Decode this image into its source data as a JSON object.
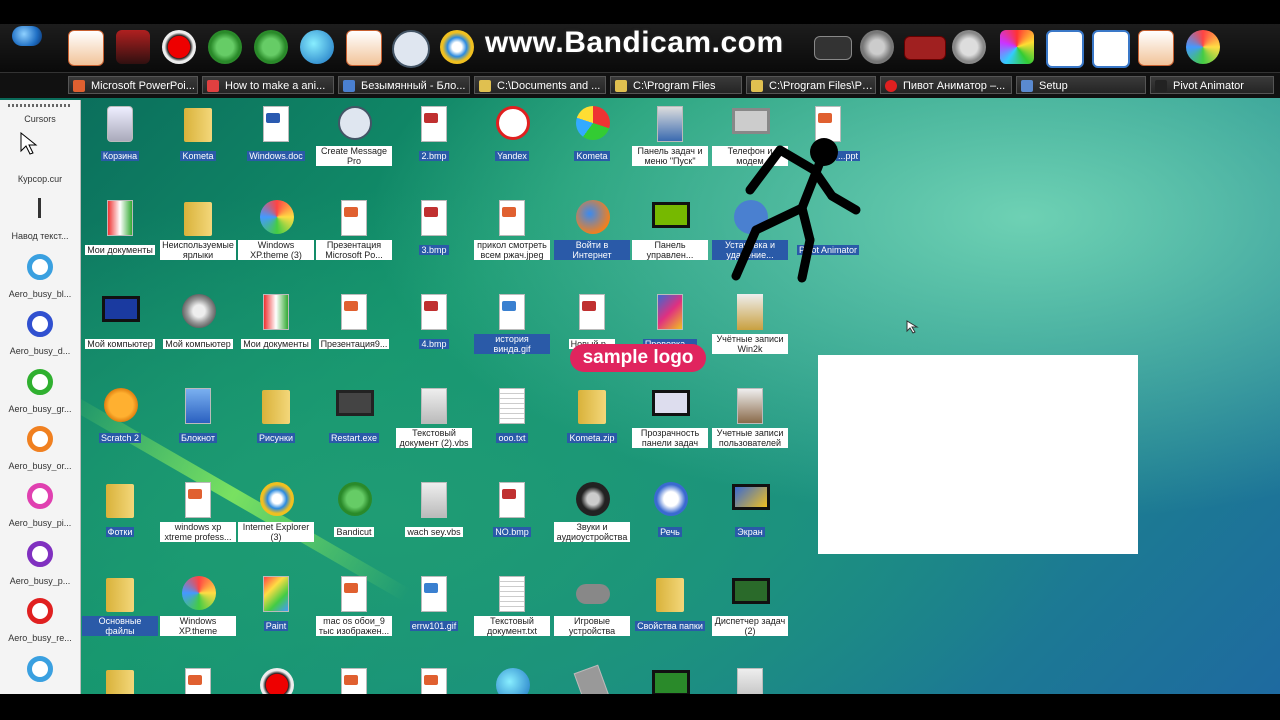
{
  "watermark": "www.Bandicam.com",
  "sample_logo": "sample logo",
  "taskbar": {
    "items": [
      {
        "label": "Microsoft PowerPoi...",
        "icon": "powerpoint-icon"
      },
      {
        "label": "How to make a ani...",
        "icon": "browser-icon"
      },
      {
        "label": "Безымянный - Бло...",
        "icon": "notepad-icon"
      },
      {
        "label": "C:\\Documents and ...",
        "icon": "folder-icon"
      },
      {
        "label": "C:\\Program Files",
        "icon": "folder-icon"
      },
      {
        "label": "C:\\Program Files\\Piv...",
        "icon": "folder-icon"
      },
      {
        "label": "Пивот Аниматор –...",
        "icon": "yandex-icon"
      },
      {
        "label": "Setup",
        "icon": "setup-icon"
      },
      {
        "label": "Pivot Animator",
        "icon": "pivot-icon"
      }
    ]
  },
  "cursor_panel": {
    "title": "Cursors",
    "items": [
      {
        "label": "Курсор.cur",
        "icon": "arrow-cursor-icon"
      },
      {
        "label": "Навод текст...",
        "icon": "text-cursor-icon"
      },
      {
        "label": "Aero_busy_bl...",
        "color": "#3aa0e0"
      },
      {
        "label": "Aero_busy_d...",
        "color": "#3050d0"
      },
      {
        "label": "Aero_busy_gr...",
        "color": "#30b030"
      },
      {
        "label": "Aero_busy_or...",
        "color": "#f08020"
      },
      {
        "label": "Aero_busy_pi...",
        "color": "#e040b0"
      },
      {
        "label": "Aero_busy_p...",
        "color": "#8030c0"
      },
      {
        "label": "Aero_busy_re...",
        "color": "#e02020"
      }
    ]
  },
  "desktop_icons": [
    {
      "label": "Корзина",
      "icon": "recycle-bin-icon"
    },
    {
      "label": "Kometa",
      "icon": "folder-icon"
    },
    {
      "label": "Windows.doc",
      "icon": "word-doc-icon"
    },
    {
      "label": "Create Message Pro",
      "icon": "rjl-icon"
    },
    {
      "label": "2.bmp",
      "icon": "bmp-icon"
    },
    {
      "label": "Yandex",
      "icon": "yandex-icon"
    },
    {
      "label": "Kometa",
      "icon": "kometa-icon"
    },
    {
      "label": "Панель задач и меню \"Пуск\"",
      "icon": "taskbar-settings-icon"
    },
    {
      "label": "Телефон и модем",
      "icon": "phone-icon"
    },
    {
      "label": "...ppt",
      "icon": "powerpoint-icon"
    },
    {
      "label": "Мои документы",
      "icon": "my-documents-icon"
    },
    {
      "label": "Неиспользуемые ярлыки",
      "icon": "folder-icon"
    },
    {
      "label": "Windows XP.theme (3)",
      "icon": "theme-icon"
    },
    {
      "label": "Презентация Microsoft Po...",
      "icon": "powerpoint-icon"
    },
    {
      "label": "3.bmp",
      "icon": "bmp-icon"
    },
    {
      "label": "прикол смотреть всем ржач.jpeg",
      "icon": "image-icon"
    },
    {
      "label": "Войти в Интернет",
      "icon": "firefox-icon"
    },
    {
      "label": "Панель управлен...",
      "icon": "nvidia-icon"
    },
    {
      "label": "Установка и удаление...",
      "icon": "add-remove-icon"
    },
    {
      "label": "Pivot Animator",
      "icon": "pivot-icon"
    },
    {
      "label": "Мой компьютер",
      "icon": "monitor-icon"
    },
    {
      "label": "Мой компьютер",
      "icon": "gears-icon"
    },
    {
      "label": "Мои документы",
      "icon": "my-documents-icon"
    },
    {
      "label": "Презентация9...",
      "icon": "powerpoint-icon"
    },
    {
      "label": "4.bmp",
      "icon": "bmp-icon"
    },
    {
      "label": "история винда.gif",
      "icon": "gif-icon"
    },
    {
      "label": "Новый р...",
      "icon": "bmp-icon"
    },
    {
      "label": "Проверка ...",
      "icon": "check-icon"
    },
    {
      "label": "Учётные записи Win2k",
      "icon": "users-lock-icon"
    },
    {
      "label": "Scratch 2",
      "icon": "scratch-icon"
    },
    {
      "label": "Блокнот",
      "icon": "notepad-icon"
    },
    {
      "label": "Рисунки",
      "icon": "folder-icon"
    },
    {
      "label": "Restart.exe",
      "icon": "restart-icon"
    },
    {
      "label": "Текстовый документ (2).vbs",
      "icon": "vbs-icon"
    },
    {
      "label": "ooo.txt",
      "icon": "txt-icon"
    },
    {
      "label": "Kometa.zip",
      "icon": "zip-icon"
    },
    {
      "label": "Прозрачность панели задач",
      "icon": "transparency-icon"
    },
    {
      "label": "Учетные записи пользователей",
      "icon": "users-icon"
    },
    {
      "label": "Фотки",
      "icon": "folder-icon"
    },
    {
      "label": "windows xp xtreme profess...",
      "icon": "powerpoint-icon"
    },
    {
      "label": "Internet Explorer (3)",
      "icon": "ie-icon"
    },
    {
      "label": "Bandicut",
      "icon": "bandicut-icon"
    },
    {
      "label": "wach sey.vbs",
      "icon": "vbs-icon"
    },
    {
      "label": "NO.bmp",
      "icon": "bmp-icon"
    },
    {
      "label": "Звуки и аудиоустройства",
      "icon": "sound-icon"
    },
    {
      "label": "Речь",
      "icon": "speech-icon"
    },
    {
      "label": "Экран",
      "icon": "display-icon"
    },
    {
      "label": "Основные файлы",
      "icon": "folder-icon"
    },
    {
      "label": "Windows XP.theme",
      "icon": "theme-icon"
    },
    {
      "label": "Paint",
      "icon": "paint-icon"
    },
    {
      "label": "mac os обои_9 тыс изображен...",
      "icon": "image-icon"
    },
    {
      "label": "errw101.gif",
      "icon": "gif-icon"
    },
    {
      "label": "Текстовый документ.txt",
      "icon": "txt-icon"
    },
    {
      "label": "Игровые устройства",
      "icon": "gamepad-icon"
    },
    {
      "label": "Свойства папки",
      "icon": "folder-options-icon"
    },
    {
      "label": "Диспетчер задач (2)",
      "icon": "task-manager-icon"
    }
  ]
}
